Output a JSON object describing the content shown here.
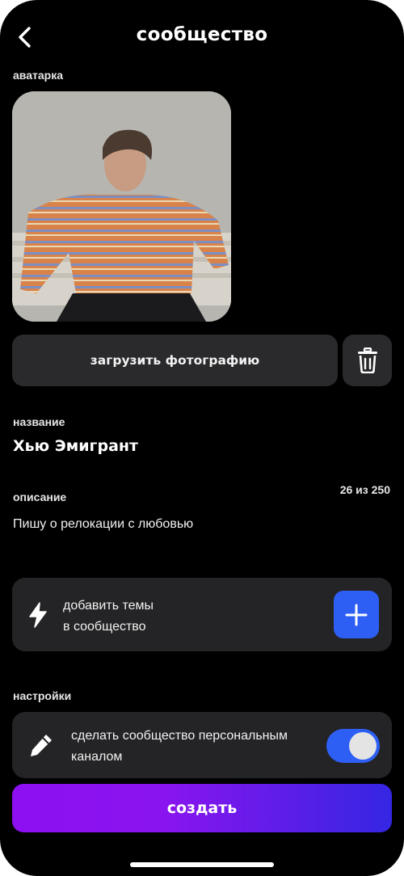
{
  "header": {
    "title": "сообщество",
    "back_icon": "chevron-left-icon"
  },
  "avatar_section": {
    "label": "аватарка",
    "upload_label": "загрузить фотографию",
    "delete_icon": "trash-icon"
  },
  "name_section": {
    "label": "название",
    "value": "Хью Эмигрант"
  },
  "description_section": {
    "label": "описание",
    "counter": "26 из 250",
    "value": "Пишу о релокации с любовью"
  },
  "topics_card": {
    "icon": "lightning-icon",
    "line1": "добавить темы",
    "line2": "в сообщество",
    "add_icon": "plus-icon"
  },
  "settings_section": {
    "label": "настройки",
    "icon": "pencil-icon",
    "line1": "сделать сообщество персональным",
    "line2": "каналом",
    "toggle_on": true
  },
  "create_label": "создать",
  "colors": {
    "accent_blue": "#2e5ff5",
    "gradient_start": "#8d10f2",
    "gradient_end": "#3526e3",
    "card": "#242426"
  }
}
